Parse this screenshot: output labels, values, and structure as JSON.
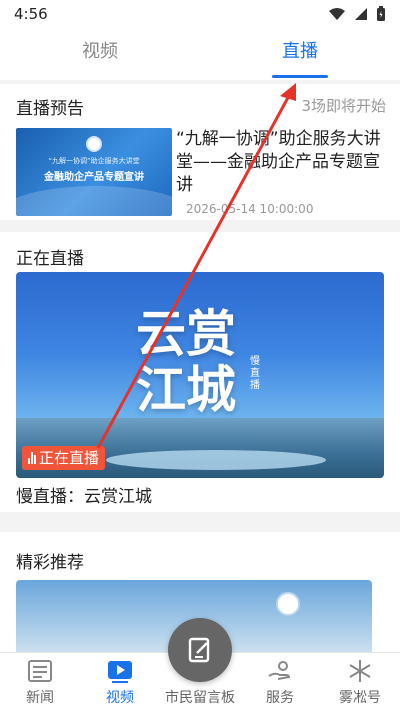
{
  "status": {
    "time": "4:56"
  },
  "tabs": [
    {
      "label": "视频"
    },
    {
      "label": "直播"
    }
  ],
  "preview": {
    "title": "直播预告",
    "more": "3场即将开始",
    "thumb_line1": "“九解一协调”助企服务大讲堂",
    "thumb_line2": "金融助企产品专题宣讲",
    "item_title": "“九解一协调”助企服务大讲堂——金融助企产品专题宣讲",
    "item_time": "2026-05-14 10:00:00"
  },
  "live": {
    "title": "正在直播",
    "banner_text": "云赏江城",
    "banner_tag": "慢直播",
    "badge": "正在直播",
    "caption": "慢直播：云赏江城"
  },
  "recommend": {
    "title": "精彩推荐"
  },
  "nav": [
    {
      "label": "新闻"
    },
    {
      "label": "视频"
    },
    {
      "label": "市民留言板"
    },
    {
      "label": "服务"
    },
    {
      "label": "雾凇号"
    }
  ],
  "colors": {
    "accent": "#1a72e8",
    "live_badge": "#f0553a",
    "annotation_arrow": "#e5332a"
  }
}
